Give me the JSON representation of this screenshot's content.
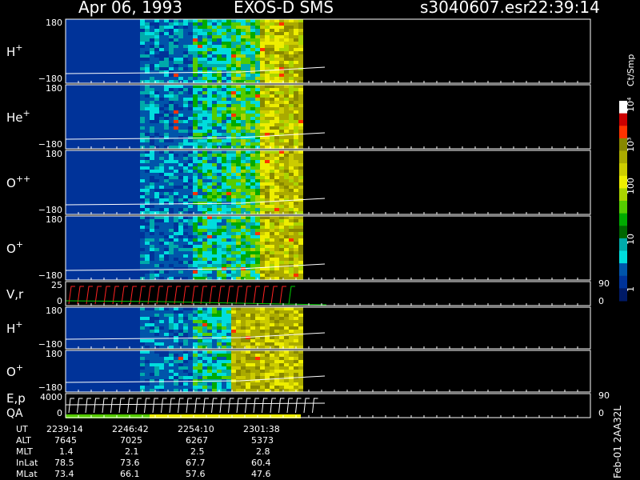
{
  "header": {
    "date": "Apr 06, 1993",
    "instrument": "EXOS-D SMS",
    "file": "s3040607.esr",
    "time": "22:39:14"
  },
  "colorbar": {
    "unit": "Ct/Smp",
    "ticks": [
      "10⁴",
      "10³",
      "100",
      "10",
      "1"
    ],
    "colors": [
      "#ffffff",
      "#cc0000",
      "#ff3300",
      "#888800",
      "#aaaa00",
      "#cccc00",
      "#eeee00",
      "#aad400",
      "#55cc00",
      "#00aa00",
      "#006600",
      "#00aaaa",
      "#00dddd",
      "#0055aa",
      "#003399",
      "#001a66"
    ]
  },
  "panels": [
    {
      "label": "H",
      "sup": "+",
      "top_tick": "180",
      "bot_tick": "−180"
    },
    {
      "label": "He",
      "sup": "+",
      "top_tick": "180",
      "bot_tick": "−180"
    },
    {
      "label": "O",
      "sup": "++",
      "top_tick": "180",
      "bot_tick": "−180"
    },
    {
      "label": "O",
      "sup": "+",
      "top_tick": "180",
      "bot_tick": "−180"
    },
    {
      "label": "V,r",
      "sup": "",
      "top_tick": "25",
      "bot_tick": "0",
      "right_top": "90",
      "right_bot": "0"
    },
    {
      "label": "H",
      "sup": "+",
      "top_tick": "180",
      "bot_tick": "−180"
    },
    {
      "label": "O",
      "sup": "+",
      "top_tick": "180",
      "bot_tick": "−180"
    },
    {
      "label": "E,p",
      "label2": "QA",
      "sup": "",
      "top_tick": "4000",
      "bot_tick": "0",
      "right_top": "90",
      "right_bot": "0"
    }
  ],
  "ephemeris": {
    "rows": [
      {
        "name": "UT",
        "values": [
          "2239:14",
          "2246:42",
          "2254:10",
          "2301:38"
        ]
      },
      {
        "name": "ALT",
        "values": [
          "7645",
          "7025",
          "6267",
          "5373"
        ]
      },
      {
        "name": "MLT",
        "values": [
          "1.4",
          "2.1",
          "2.5",
          "2.8"
        ]
      },
      {
        "name": "InLat",
        "values": [
          "78.5",
          "73.6",
          "67.7",
          "60.4"
        ]
      },
      {
        "name": "MLat",
        "values": [
          "73.4",
          "66.1",
          "57.6",
          "47.6"
        ]
      }
    ]
  },
  "footer_vertical": "Feb-01 2AA32L",
  "chart_data": {
    "type": "heatmap",
    "title": "Apr 06, 1993   EXOS-D SMS",
    "x": [
      "2239:14",
      "2246:42",
      "2254:10",
      "2301:38"
    ],
    "xlabel": "UT",
    "series": [
      {
        "name": "H+",
        "ylim": [
          -180,
          180
        ]
      },
      {
        "name": "He+",
        "ylim": [
          -180,
          180
        ]
      },
      {
        "name": "O++",
        "ylim": [
          -180,
          180
        ]
      },
      {
        "name": "O+",
        "ylim": [
          -180,
          180
        ]
      },
      {
        "name": "V,r",
        "ylim": [
          0,
          25
        ]
      },
      {
        "name": "H+",
        "ylim": [
          -180,
          180
        ]
      },
      {
        "name": "O+",
        "ylim": [
          -180,
          180
        ]
      },
      {
        "name": "E,p",
        "ylim": [
          0,
          4000
        ]
      }
    ],
    "colorscale": {
      "label": "Ct/Smp",
      "range": [
        1,
        10000
      ],
      "scale": "log"
    }
  }
}
